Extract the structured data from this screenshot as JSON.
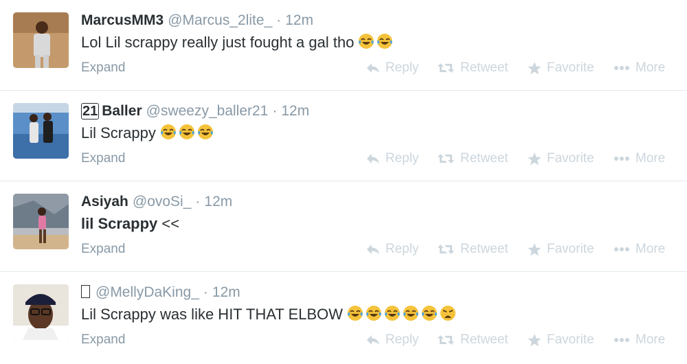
{
  "actions": {
    "reply": "Reply",
    "retweet": "Retweet",
    "favorite": "Favorite",
    "more": "More",
    "expand": "Expand"
  },
  "icons": {
    "reply": "reply-arrow-icon",
    "retweet": "retweet-icon",
    "favorite": "star-icon",
    "more": "ellipsis-icon",
    "emoji_tears": "face-with-tears-of-joy-icon",
    "emoji_weary": "weary-face-icon"
  },
  "colors": {
    "meta": "#8899a6",
    "action": "#ccd6dd",
    "divider": "#e1e8ed",
    "text": "#292f33",
    "emoji": "#f5c33b"
  },
  "tweets": [
    {
      "fullname": "MarcusMM3",
      "handle": "@Marcus_2lite_",
      "sep": "·",
      "time": "12m",
      "text": "Lol Lil scrappy really just fought a gal tho",
      "emoji": [
        "tears",
        "tears"
      ]
    },
    {
      "fullname": "2️⃣1️⃣Baller",
      "name_prefix": "21",
      "name_rest": "Baller",
      "handle": "@sweezy_baller21",
      "sep": "·",
      "time": "12m",
      "text": "Lil Scrappy",
      "emoji": [
        "tears",
        "tears",
        "tears"
      ]
    },
    {
      "fullname": "Asiyah",
      "handle": "@ovoSi_",
      "sep": "·",
      "time": "12m",
      "text": "lil Scrappy",
      "text_suffix": "<<",
      "emoji": []
    },
    {
      "fullname": "",
      "handle": "@MellyDaKing_",
      "sep": "·",
      "time": "12m",
      "text": "Lil Scrappy was like HIT THAT ELBOW",
      "emoji": [
        "tears",
        "tears",
        "tears",
        "tears",
        "tears",
        "weary"
      ]
    }
  ]
}
